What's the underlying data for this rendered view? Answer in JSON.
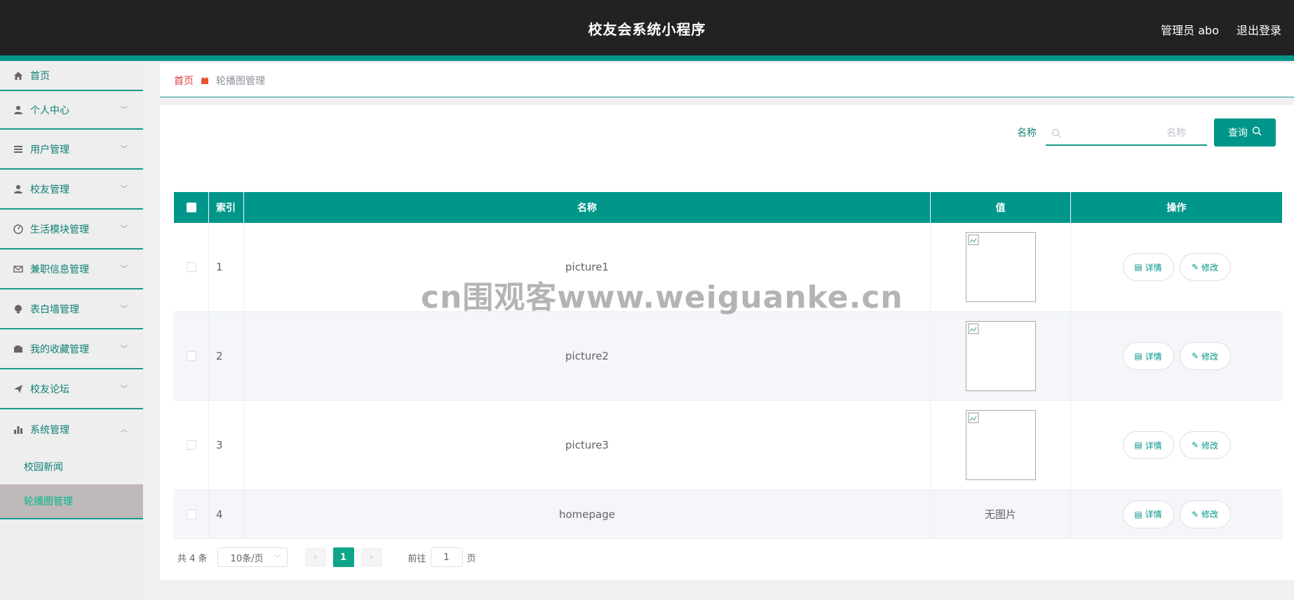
{
  "header": {
    "app_title": "校友会系统小程序",
    "user_label": "管理员 abo",
    "logout_label": "退出登录"
  },
  "sidebar": {
    "items": [
      {
        "label": "首页",
        "icon": "home-icon"
      },
      {
        "label": "个人中心",
        "icon": "user-icon"
      },
      {
        "label": "用户管理",
        "icon": "list-icon"
      },
      {
        "label": "校友管理",
        "icon": "user-icon"
      },
      {
        "label": "生活模块管理",
        "icon": "gauge-icon"
      },
      {
        "label": "兼职信息管理",
        "icon": "mail-icon"
      },
      {
        "label": "表白墙管理",
        "icon": "bulb-icon"
      },
      {
        "label": "我的收藏管理",
        "icon": "wallet-icon"
      },
      {
        "label": "校友论坛",
        "icon": "send-icon"
      },
      {
        "label": "系统管理",
        "icon": "chart-icon"
      }
    ],
    "subitems": [
      {
        "label": "校园新闻"
      },
      {
        "label": "轮播图管理"
      }
    ]
  },
  "breadcrumb": {
    "home": "首页",
    "current": "轮播图管理"
  },
  "search": {
    "label": "名称",
    "placeholder": "名称",
    "button": "查询"
  },
  "table": {
    "headers": {
      "index": "索引",
      "name": "名称",
      "value": "值",
      "ops": "操作"
    },
    "rows": [
      {
        "index": "1",
        "name": "picture1",
        "value": "",
        "detail": "详情",
        "edit": "修改"
      },
      {
        "index": "2",
        "name": "picture2",
        "value": "",
        "detail": "详情",
        "edit": "修改"
      },
      {
        "index": "3",
        "name": "picture3",
        "value": "",
        "detail": "详情",
        "edit": "修改"
      },
      {
        "index": "4",
        "name": "homepage",
        "value": "无图片",
        "detail": "详情",
        "edit": "修改"
      }
    ]
  },
  "pagination": {
    "total": "共 4 条",
    "page_size": "10条/页",
    "current_page": "1",
    "jump_prefix": "前往",
    "jump_value": "1",
    "jump_suffix": "页"
  },
  "watermark": "cn围观客www.weiguanke.cn",
  "colors": {
    "accent": "#00968a",
    "header_bg": "#222222",
    "breadcrumb_home": "#e03c3c"
  }
}
